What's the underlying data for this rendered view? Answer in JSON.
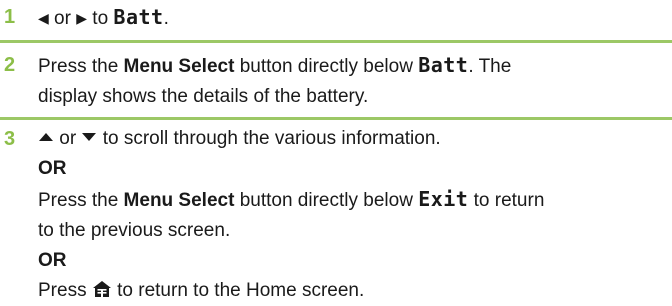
{
  "steps": [
    {
      "number": "1",
      "parts": {
        "left_or": " or ",
        "to": " to ",
        "target": "Batt",
        "end": "."
      }
    },
    {
      "number": "2",
      "line1": {
        "pre": "Press the ",
        "bold": "Menu Select",
        "mid": " button directly below ",
        "lcd": "Batt",
        "post": ". The"
      },
      "line2": "display shows the details of the battery."
    },
    {
      "number": "3",
      "line1": {
        "or": " or ",
        "post": " to scroll through the various information."
      },
      "or_label_1": "OR",
      "line3": {
        "pre": "Press the ",
        "bold": "Menu Select",
        "mid": " button directly below ",
        "lcd": "Exit",
        "post": " to return"
      },
      "line4": "to the previous screen.",
      "or_label_2": "OR",
      "line6": {
        "pre": "Press ",
        "post": " to return to the Home screen."
      }
    }
  ],
  "colors": {
    "accent": "#8cbe48",
    "divider": "#9cc866",
    "text": "#1a1a1a"
  },
  "icons": [
    "left-arrow-icon",
    "right-arrow-icon",
    "up-arrow-icon",
    "down-arrow-icon",
    "home-icon"
  ]
}
